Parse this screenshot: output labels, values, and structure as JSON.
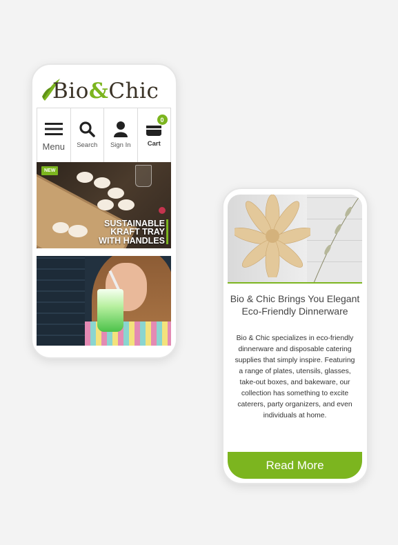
{
  "brand": {
    "name_part1": "Bio",
    "name_amp": "&",
    "name_part2": "Chic",
    "accent": "#7cb51f"
  },
  "nav": {
    "items": [
      {
        "label": "Menu",
        "icon": "hamburger-icon"
      },
      {
        "label": "Search",
        "icon": "search-icon"
      },
      {
        "label": "Sign In",
        "icon": "user-icon"
      },
      {
        "label": "Cart",
        "icon": "cart-icon",
        "badge": "0"
      }
    ]
  },
  "banners": [
    {
      "badge": "NEW",
      "caption_lines": [
        "SUSTAINABLE",
        "KRAFT TRAY",
        "WITH HANDLES"
      ]
    }
  ],
  "article": {
    "title": "Bio & Chic Brings You Elegant Eco-Friendly Dinnerware",
    "body": "Bio & Chic specializes in eco-friendly dinnerware and disposable catering supplies that simply inspire. Featuring a range of plates, utensils, glasses, take-out boxes, and bakeware, our collection has something to excite caterers, party organizers, and even individuals at home.",
    "button_label": "Read More"
  }
}
